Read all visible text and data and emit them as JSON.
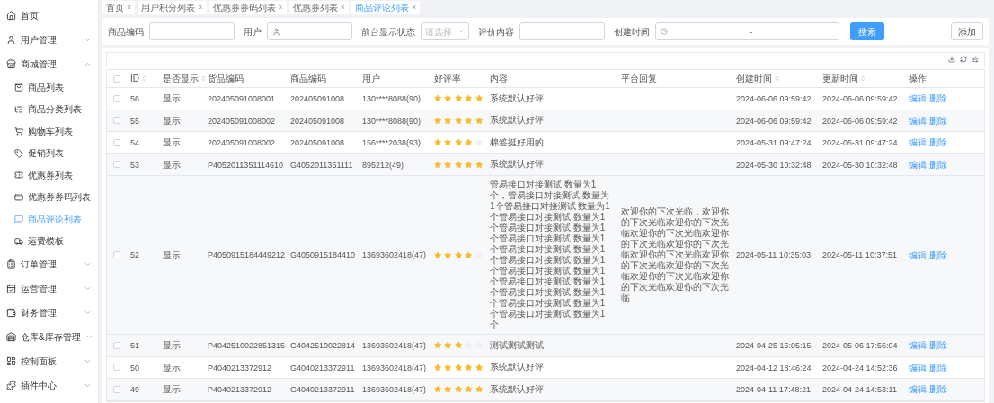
{
  "sidebar": {
    "items": [
      {
        "label": "首页"
      },
      {
        "label": "用户管理",
        "expanded": false
      },
      {
        "label": "商城管理",
        "expanded": true,
        "children": [
          {
            "label": "商品列表",
            "selected": false
          },
          {
            "label": "商品分类列表",
            "selected": false
          },
          {
            "label": "购物车列表",
            "selected": false
          },
          {
            "label": "促销列表",
            "selected": false
          },
          {
            "label": "优惠券列表",
            "selected": false
          },
          {
            "label": "优惠券券码列表",
            "selected": false
          },
          {
            "label": "商品评论列表",
            "selected": true
          },
          {
            "label": "运费模板",
            "selected": false
          }
        ]
      },
      {
        "label": "订单管理",
        "expanded": false
      },
      {
        "label": "运营管理",
        "expanded": false
      },
      {
        "label": "财务管理",
        "expanded": false
      },
      {
        "label": "仓库&库存管理",
        "expanded": false
      },
      {
        "label": "控制面板",
        "expanded": false
      },
      {
        "label": "插件中心",
        "expanded": false
      }
    ]
  },
  "tabs": [
    {
      "label": "首页",
      "selected": false,
      "close": "×"
    },
    {
      "label": "用户积分列表",
      "selected": false,
      "close": "×"
    },
    {
      "label": "优惠券券码列表",
      "selected": false,
      "close": "×"
    },
    {
      "label": "优惠券列表",
      "selected": false,
      "close": "×"
    },
    {
      "label": "商品评论列表",
      "selected": true,
      "close": "×"
    }
  ],
  "filters": [
    {
      "kind": "input",
      "label": "商品编码"
    },
    {
      "kind": "user",
      "label": "用户"
    },
    {
      "kind": "select",
      "label": "前台显示状态",
      "placeholder": "请选择"
    },
    {
      "kind": "input",
      "label": "评价内容"
    },
    {
      "kind": "daterange",
      "label": "创建时间",
      "separator": "-"
    }
  ],
  "search_button": "搜索",
  "add_button": "添加",
  "table": {
    "all_checked": false,
    "columns": [
      {
        "label": "ID",
        "sortable": true
      },
      {
        "label": "是否显示",
        "sortable": true
      },
      {
        "label": "货品编码",
        "sortable": false
      },
      {
        "label": "商品编码",
        "sortable": false
      },
      {
        "label": "用户",
        "sortable": false
      },
      {
        "label": "好评率",
        "sortable": false
      },
      {
        "label": "内容",
        "sortable": false
      },
      {
        "label": "平台回复",
        "sortable": false
      },
      {
        "label": "创建时间",
        "sortable": true
      },
      {
        "label": "更新时间",
        "sortable": true
      },
      {
        "label": "操作",
        "sortable": false
      }
    ],
    "rows": [
      {
        "checked": false,
        "id": "56",
        "show": "显示",
        "goods_code": "202405091008001",
        "product_code": "202405091008",
        "user": "130****8088(90)",
        "stars": 5,
        "content": "系统默认好评",
        "reply": "",
        "created": "2024-06-06 09:59:42",
        "updated": "2024-06-06 09:59:42",
        "actions": [
          "编辑",
          "删除"
        ]
      },
      {
        "checked": false,
        "id": "55",
        "show": "显示",
        "goods_code": "202405091008002",
        "product_code": "202405091008",
        "user": "130****8088(90)",
        "stars": 5,
        "content": "系统默认好评",
        "reply": "",
        "created": "2024-06-06 09:59:42",
        "updated": "2024-06-06 09:59:42",
        "actions": [
          "编辑",
          "删除"
        ]
      },
      {
        "checked": false,
        "id": "54",
        "show": "显示",
        "goods_code": "202405091008002",
        "product_code": "202405091008",
        "user": "156****2038(93)",
        "stars": 4,
        "content": "棉签挺好用的",
        "reply": "",
        "created": "2024-05-31 09:47:24",
        "updated": "2024-05-31 09:47:24",
        "actions": [
          "编辑",
          "删除"
        ]
      },
      {
        "checked": false,
        "id": "53",
        "show": "显示",
        "goods_code": "P4052011351114610",
        "product_code": "G4052011351111",
        "user": "895212(49)",
        "stars": 5,
        "content": "系统默认好评",
        "reply": "",
        "created": "2024-05-30 10:32:48",
        "updated": "2024-05-30 10:32:48",
        "actions": [
          "编辑",
          "删除"
        ]
      },
      {
        "checked": false,
        "id": "52",
        "show": "显示",
        "goods_code": "P4050915184449212",
        "product_code": "G4050915184410",
        "user": "13693602418(47)",
        "stars": 4,
        "content": "管易接口对接测试 数量为1个，管易接口对接测试 数量为1个管易接口对接测试 数量为1个管易接口对接测试 数量为1个管易接口对接测试 数量为1个管易接口对接测试 数量为1个管易接口对接测试 数量为1个管易接口对接测试 数量为1个管易接口对接测试 数量为1个管易接口对接测试 数量为1个管易接口对接测试 数量为1个管易接口对接测试 数量为1个管易接口对接测试 数量为1个",
        "reply": "欢迎你的下次光临，欢迎你的下次光临欢迎你的下次光临欢迎你的下次光临欢迎你的下次光临欢迎你的下次光临欢迎你的下次光临欢迎你的下次光临欢迎你的下次光临欢迎你的下次光临欢迎你的下次光临欢迎你的下次光临",
        "created": "2024-05-11 10:35:03",
        "updated": "2024-05-11 10:37:51",
        "actions": [
          "编辑",
          "删除"
        ]
      },
      {
        "checked": false,
        "id": "51",
        "show": "显示",
        "goods_code": "P4042510022851315",
        "product_code": "G4042510022814",
        "user": "13693602418(47)",
        "stars": 3,
        "content": "测试测试测试",
        "reply": "",
        "created": "2024-04-25 15:05:15",
        "updated": "2024-05-06 17:56:04",
        "actions": [
          "编辑",
          "删除"
        ]
      },
      {
        "checked": false,
        "id": "50",
        "show": "显示",
        "goods_code": "P4040213372912",
        "product_code": "G4040213372911",
        "user": "13693602418(47)",
        "stars": 5,
        "content": "系统默认好评",
        "reply": "",
        "created": "2024-04-12 18:46:24",
        "updated": "2024-04-24 14:52:36",
        "actions": [
          "编辑",
          "删除"
        ]
      },
      {
        "checked": false,
        "id": "49",
        "show": "显示",
        "goods_code": "P4040213372912",
        "product_code": "G4040213372911",
        "user": "13693602418(47)",
        "stars": 5,
        "content": "系统默认好评",
        "reply": "",
        "created": "2024-04-11 17:48:21",
        "updated": "2024-04-24 14:53:11",
        "actions": [
          "编辑",
          "删除"
        ]
      }
    ]
  }
}
